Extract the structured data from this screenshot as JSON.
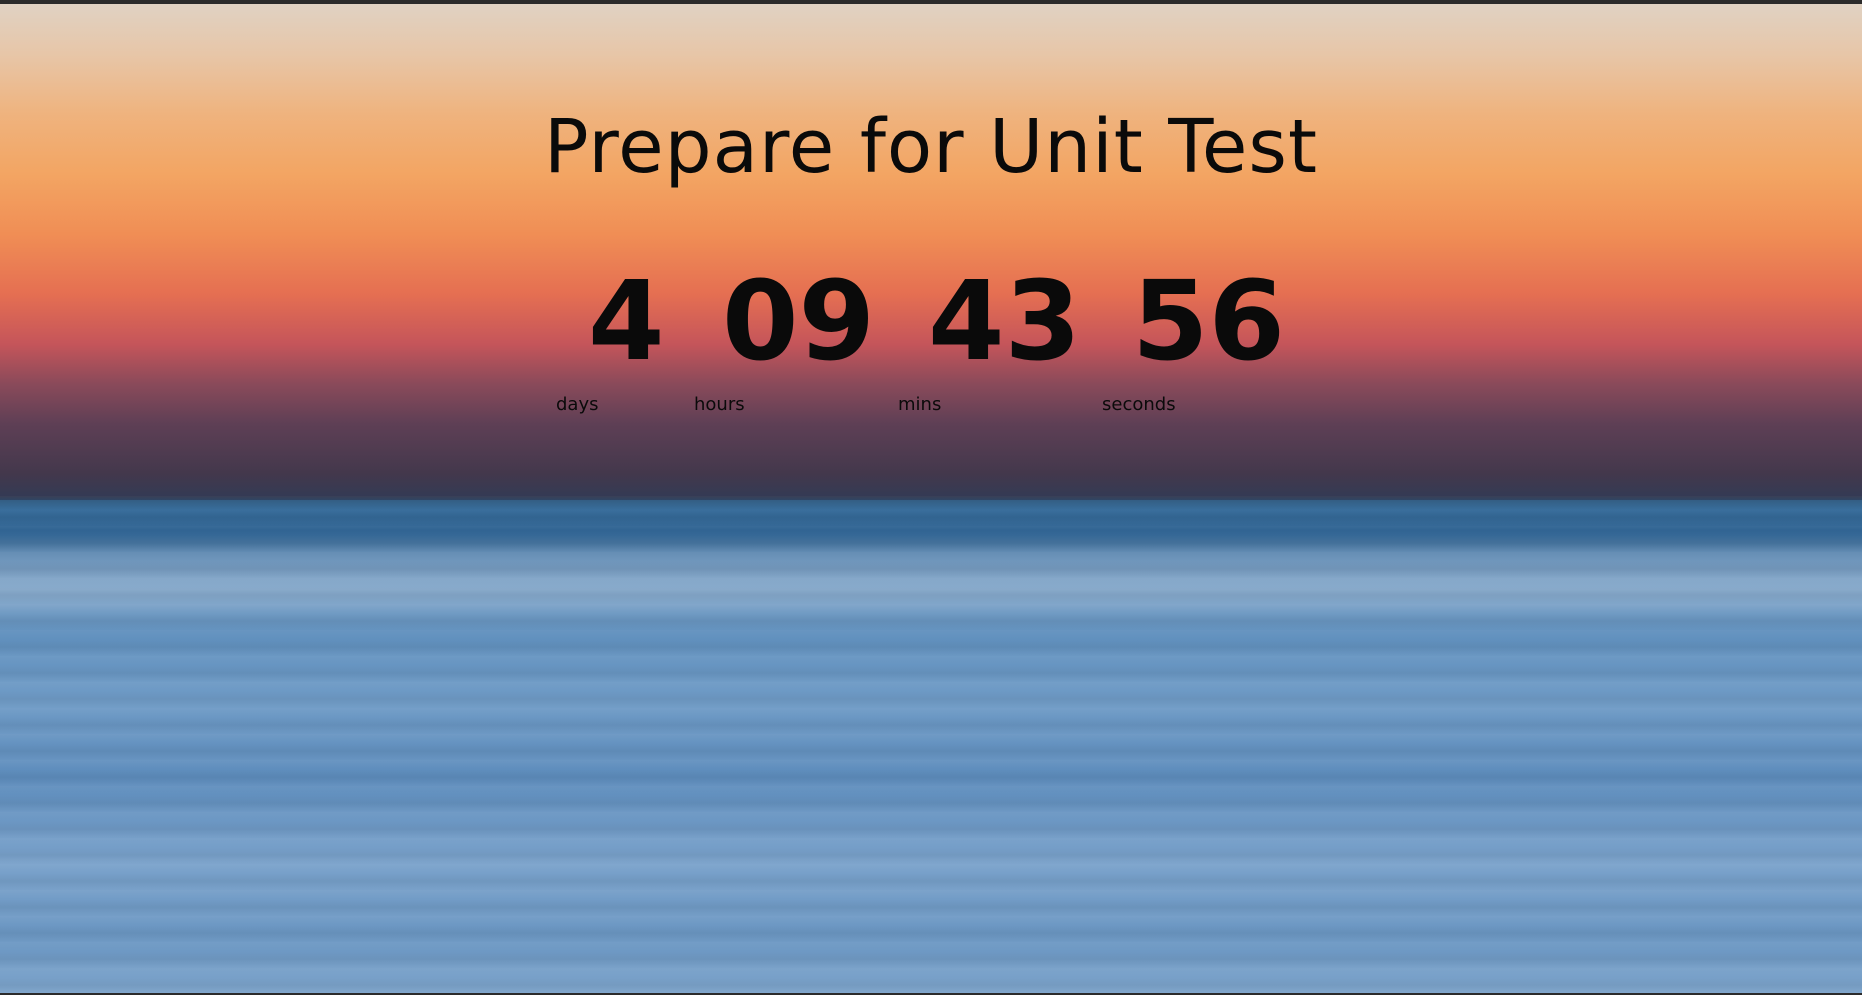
{
  "page": {
    "title": "Prepare for Unit Test"
  },
  "countdown": {
    "days": {
      "value": "4",
      "label": "days"
    },
    "hours": {
      "value": "09",
      "label": "hours"
    },
    "mins": {
      "value": "43",
      "label": "mins"
    },
    "seconds": {
      "value": "56",
      "label": "seconds"
    }
  },
  "colors": {
    "text": "#0a0a0a",
    "sky_top": "#e0d2c3",
    "sky_orange": "#f3a563",
    "sky_red": "#e56f52",
    "sea_blue": "#6f9bc6"
  }
}
